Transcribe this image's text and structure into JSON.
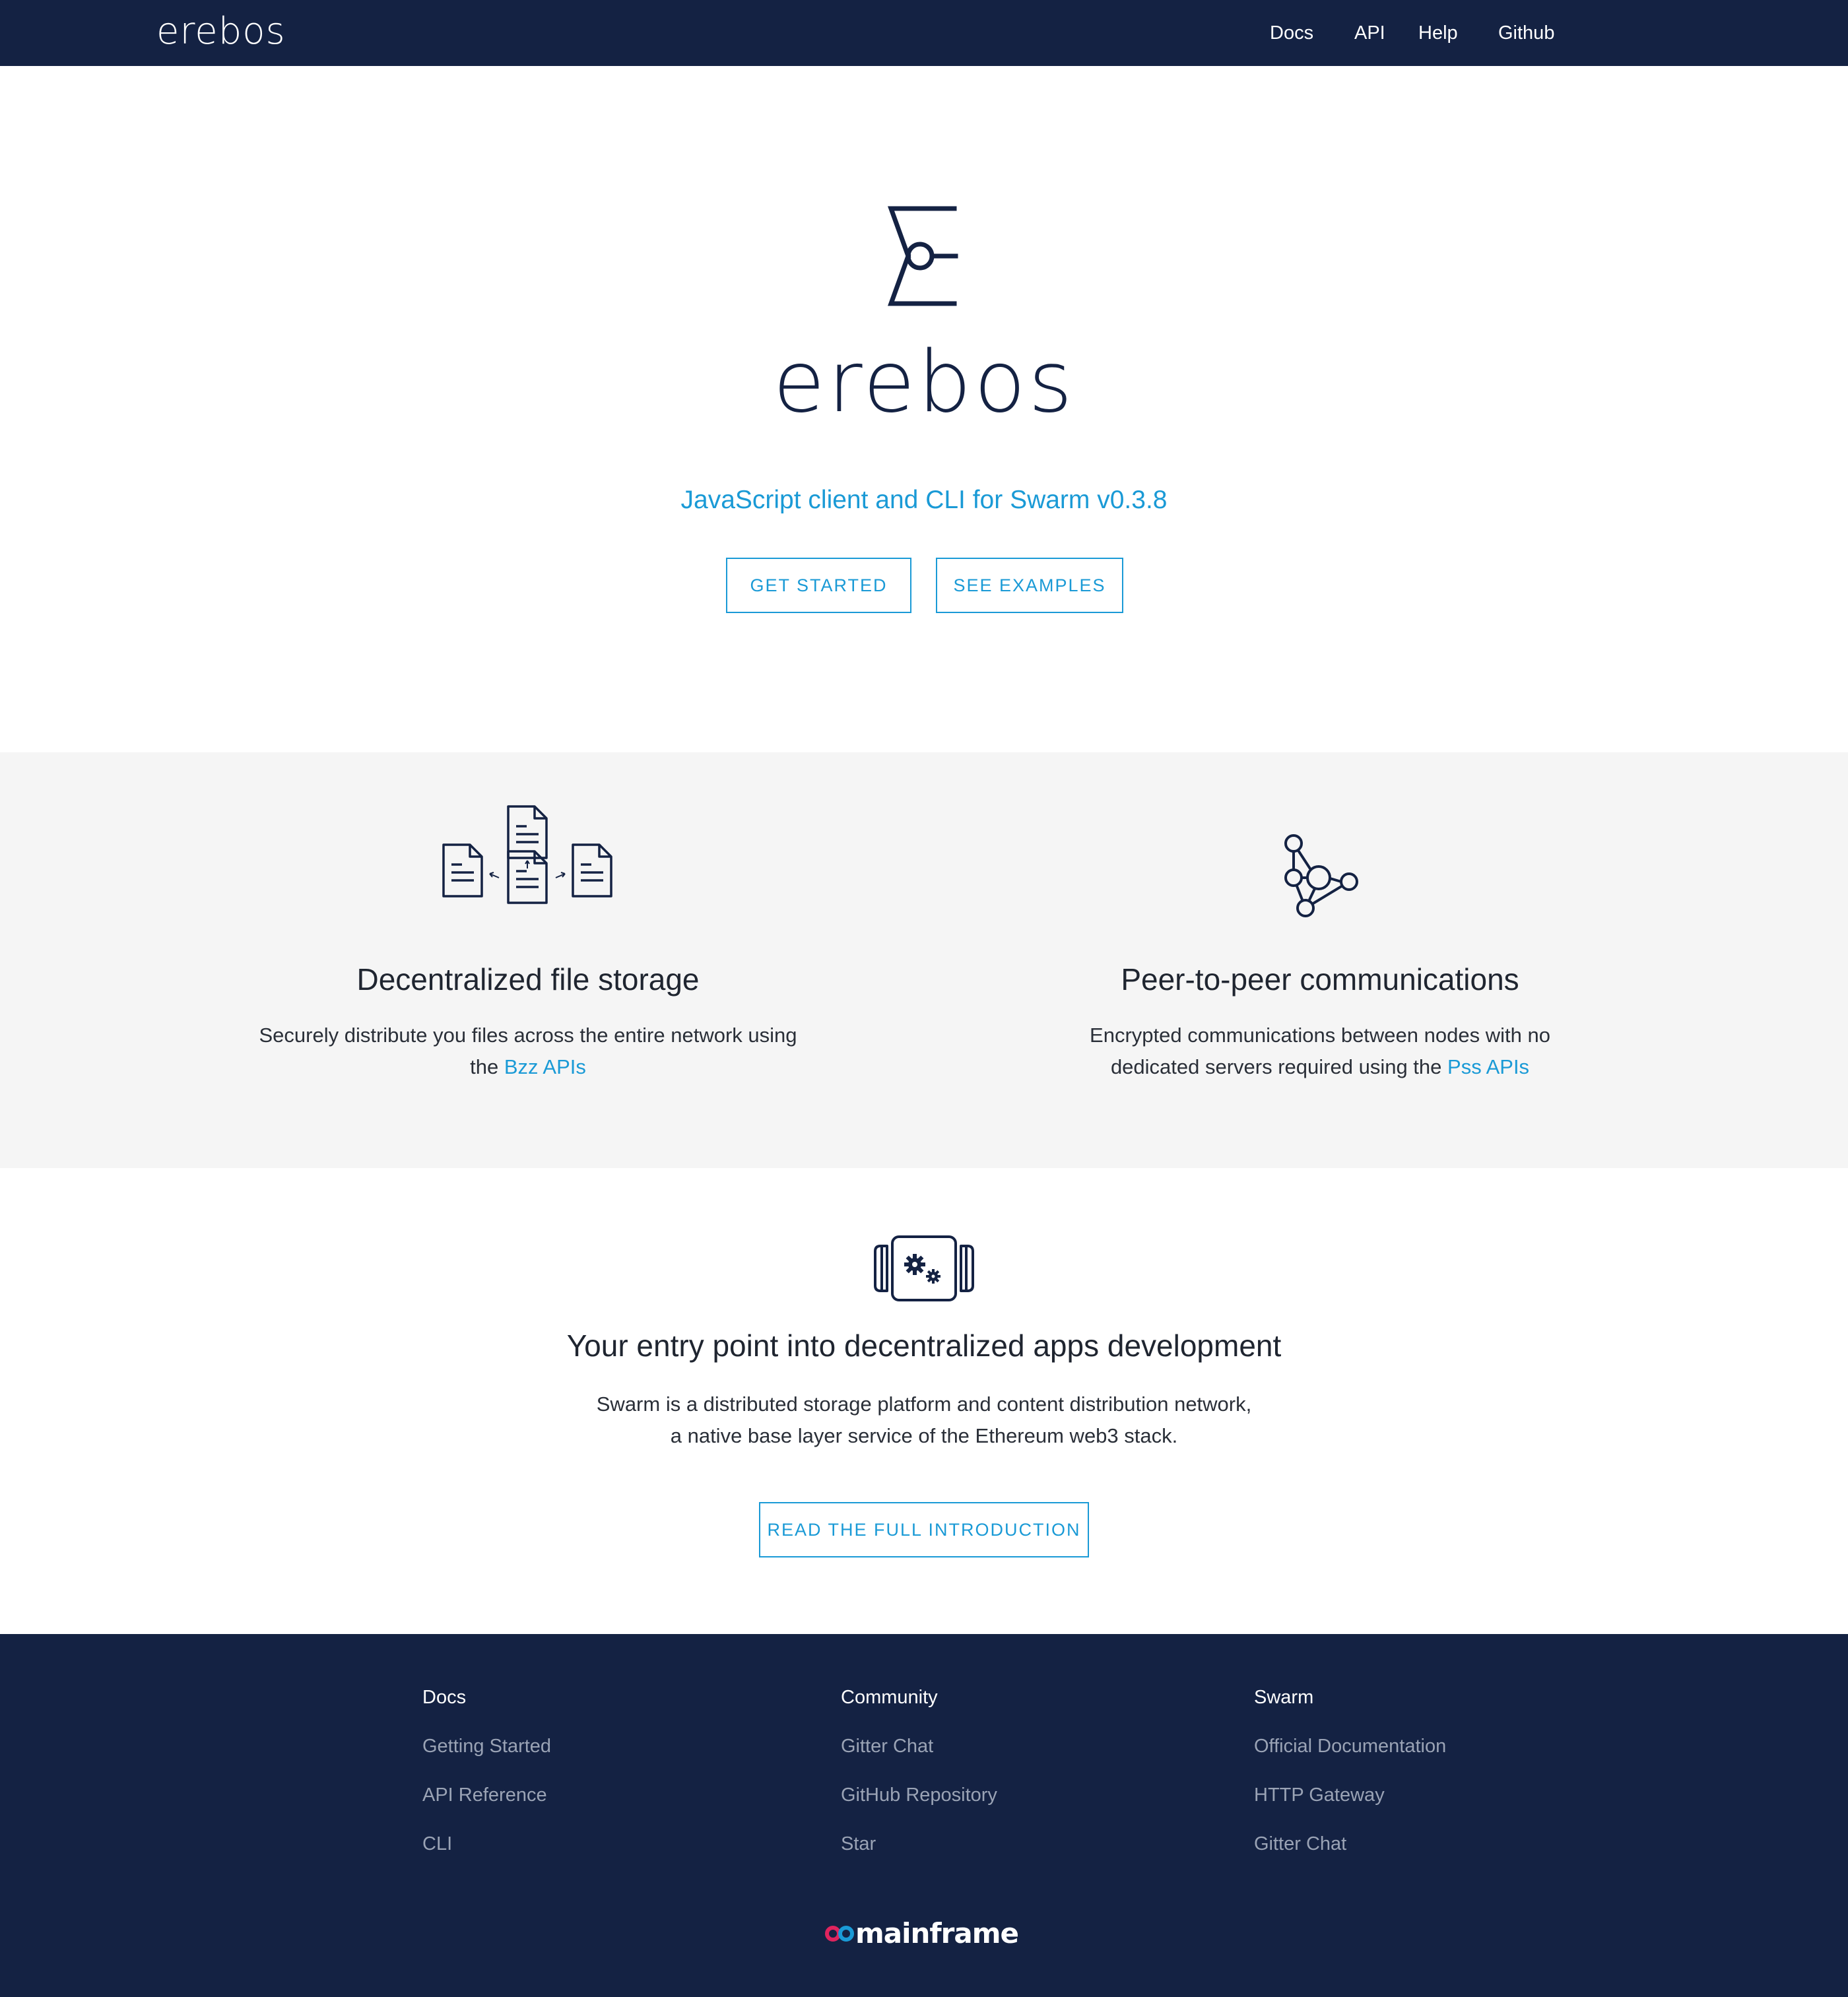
{
  "nav": {
    "brand": "erebos",
    "links": [
      "Docs",
      "API",
      "Help",
      "Github"
    ]
  },
  "hero": {
    "title": "erebos",
    "tagline": "JavaScript client and CLI for Swarm v0.3.8",
    "buttons": [
      "GET STARTED",
      "SEE EXAMPLES"
    ]
  },
  "features": [
    {
      "icon": "file-storage-icon",
      "title": "Decentralized file storage",
      "desc_line1": "Securely distribute you files across the entire network using",
      "desc_line2_prefix": "the ",
      "link": "Bzz APIs"
    },
    {
      "icon": "network-nodes-icon",
      "title": "Peer-to-peer communications",
      "desc_line1": "Encrypted communications between nodes with no",
      "desc_line2_prefix": "dedicated servers required using the ",
      "link": "Pss APIs"
    }
  ],
  "intro": {
    "icon": "gear-device-icon",
    "title": "Your entry point into decentralized apps development",
    "desc_line1": "Swarm is a distributed storage platform and content distribution network,",
    "desc_line2": "a native base layer service of the Ethereum web3 stack.",
    "button": "READ THE FULL INTRODUCTION"
  },
  "footer": {
    "columns": [
      {
        "heading": "Docs",
        "links": [
          "Getting Started",
          "API Reference",
          "CLI"
        ]
      },
      {
        "heading": "Community",
        "links": [
          "Gitter Chat",
          "GitHub Repository",
          "Star"
        ]
      },
      {
        "heading": "Swarm",
        "links": [
          "Official Documentation",
          "HTTP Gateway",
          "Gitter Chat"
        ]
      }
    ],
    "logo_text": "mainframe"
  },
  "colors": {
    "navy": "#142243",
    "accent": "#1a9ad6",
    "light_gray": "#f5f5f5",
    "footer_link": "#9aa3b5"
  }
}
